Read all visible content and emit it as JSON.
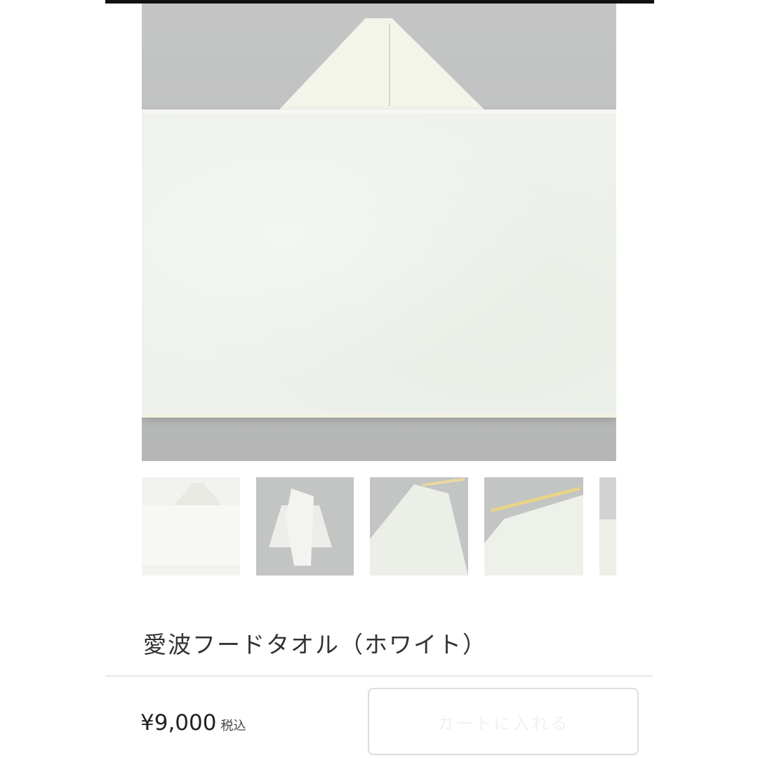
{
  "product": {
    "title": "愛波フードタオル（ホワイト）",
    "price": "¥9,000",
    "tax_label": "税込",
    "main_image_alt": "hooded towel flat lay",
    "thumbnail_count": 5
  },
  "cart_button": {
    "label": "カートに入れる"
  }
}
